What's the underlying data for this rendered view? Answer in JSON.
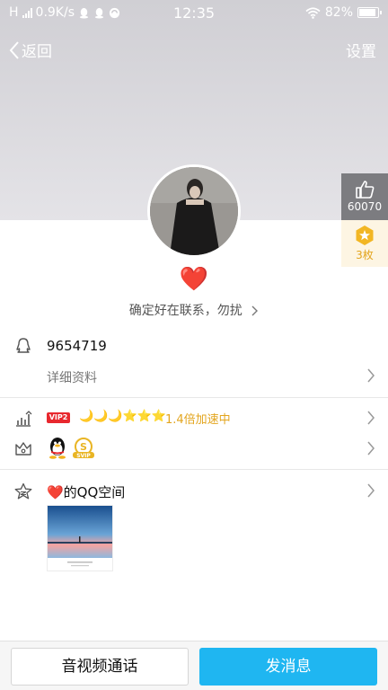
{
  "status_bar": {
    "network_type": "H",
    "speed": "0.9K/s",
    "time": "12:35",
    "battery": "82%"
  },
  "nav": {
    "back_label": "返回",
    "settings_label": "设置"
  },
  "side_badges": {
    "like_count": "60070",
    "medal_count": "3枚"
  },
  "profile": {
    "nickname_emoji": "❤️",
    "signature": "确定好在联系，勿扰",
    "qq_number": "9654719",
    "detail_label": "详细资料"
  },
  "vip_row": {
    "vip_badge": "VIP2",
    "level_icons": "🌙🌙🌙⭐⭐⭐",
    "speed_text": "1.4倍加速中"
  },
  "qzone": {
    "title": "❤️的QQ空间"
  },
  "bottom_bar": {
    "call_label": "音视频通话",
    "message_label": "发消息"
  },
  "colors": {
    "accent": "#1fb6f1",
    "vip_red": "#e8282e",
    "gold": "#e3a51e"
  }
}
